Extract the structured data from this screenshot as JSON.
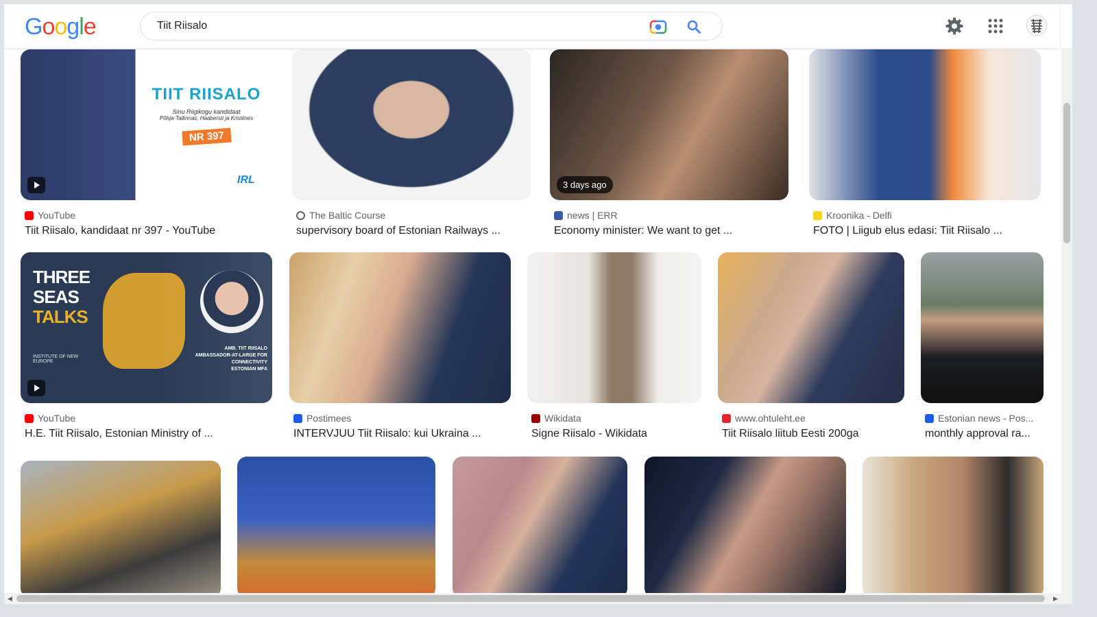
{
  "search": {
    "query": "Tiit Riisalo"
  },
  "logo": {
    "letters": [
      "G",
      "o",
      "o",
      "g",
      "l",
      "e"
    ],
    "colors": [
      "#4285f4",
      "#ea4335",
      "#fbbc05",
      "#4285f4",
      "#34a853",
      "#ea4335"
    ]
  },
  "icons": {
    "camera": "camera-icon",
    "search": "search-icon",
    "settings": "gear-icon",
    "apps": "apps-grid-icon",
    "account": "account-avatar"
  },
  "results": [
    {
      "source": "YouTube",
      "title": "Tiit Riisalo, kandidaat nr 397 - YouTube",
      "favicon_color": "#ff0000",
      "video": true,
      "overlay": {
        "name": "TIIT RIISALO",
        "sub1": "Sinu Riigikogu kandidaat",
        "sub2": "Põhja-Tallinnas, Haabersti ja Kristiines",
        "nr": "NR 397",
        "party": "IRL"
      }
    },
    {
      "source": "The Baltic Course",
      "title": "supervisory board of Estonian Railways ...",
      "favicon_color": "#5f6368"
    },
    {
      "source": "news | ERR",
      "title": "Economy minister: We want to get ...",
      "favicon_color": "#3b5ba5",
      "badge": "3 days ago"
    },
    {
      "source": "Kroonika - Delfi",
      "title": "FOTO | Liigub elus edasi: Tiit Riisalo ...",
      "favicon_color": "#f7d417"
    },
    {
      "source": "YouTube",
      "title": "H.E. Tiit Riisalo, Estonian Ministry of ...",
      "favicon_color": "#ff0000",
      "video": true,
      "overlay": {
        "l1": "THREE",
        "l2": "SEAS",
        "l3": "TALKS",
        "caption1": "AMB. TIIT RIISALO",
        "caption2": "AMBASSADOR-AT-LARGE FOR CONNECTIVITY",
        "caption3": "ESTONIAN MFA",
        "org": "INSTITUTE OF NEW EUROPE"
      }
    },
    {
      "source": "Postimees",
      "title": "INTERVJUU Tiit Riisalo: kui Ukraina ...",
      "favicon_color": "#1a5ce6"
    },
    {
      "source": "Wikidata",
      "title": "Signe Riisalo - Wikidata",
      "favicon_color": "#990000"
    },
    {
      "source": "www.ohtuleht.ee",
      "title": "Tiit Riisalo liitub Eesti 200ga",
      "favicon_color": "#e4262b"
    },
    {
      "source": "Estonian news - Pos...",
      "title": "monthly approval ra...",
      "favicon_color": "#1a5ce6"
    },
    {
      "source": "",
      "title": ""
    },
    {
      "source": "",
      "title": ""
    },
    {
      "source": "",
      "title": ""
    },
    {
      "source": "",
      "title": ""
    },
    {
      "source": "",
      "title": ""
    }
  ]
}
